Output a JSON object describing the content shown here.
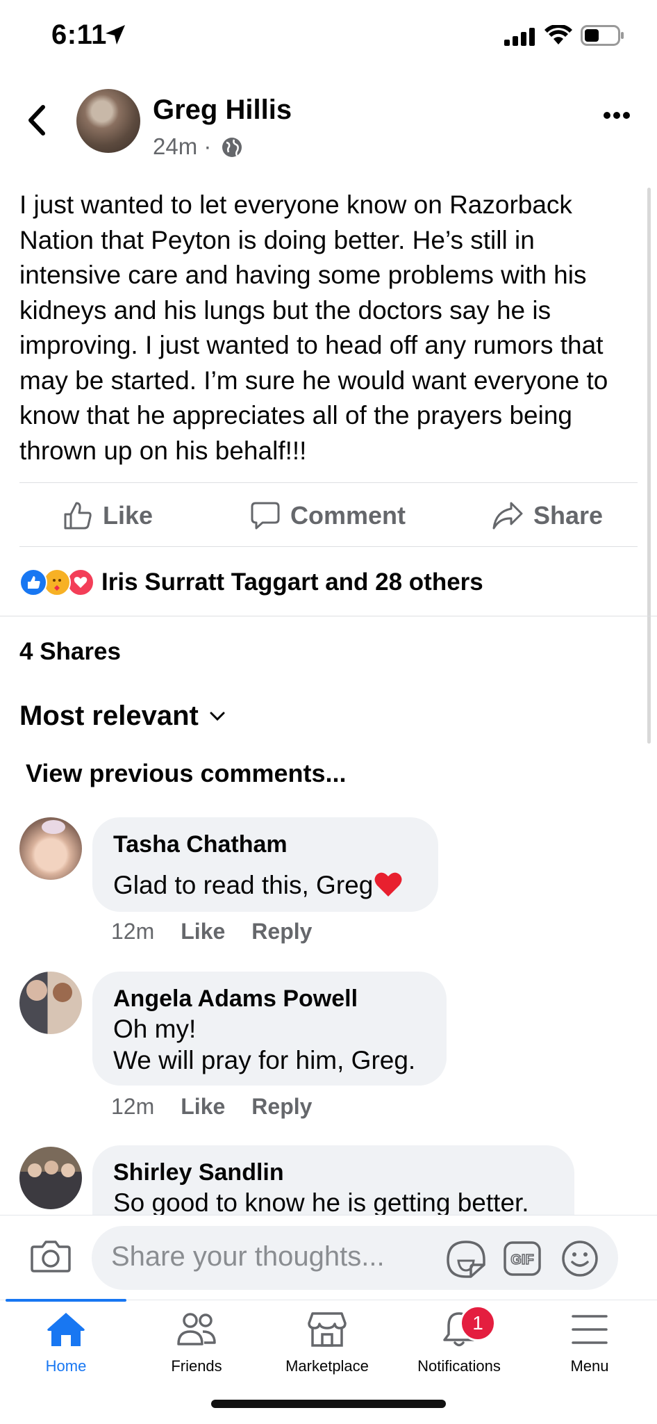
{
  "status_bar": {
    "time": "6:11"
  },
  "post": {
    "author": "Greg Hillis",
    "time": "24m ·",
    "body": "I just wanted to let everyone know on Razorback Nation that Peyton is doing better. He’s still in intensive care and having some problems with his kidneys and his lungs but the doctors say he is improving. I just wanted to head off any rumors that may be started. I’m sure he would want everyone to know that he appreciates all of the prayers being thrown up on his behalf!!!",
    "actions": {
      "like": "Like",
      "comment": "Comment",
      "share": "Share"
    },
    "reactions_text": "Iris Surratt Taggart and 28 others",
    "shares_text": "4 Shares"
  },
  "comments_section": {
    "sort_label": "Most relevant",
    "view_previous": "View previous comments...",
    "comments": [
      {
        "name": "Tasha Chatham",
        "text": "Glad to read this, Greg",
        "time": "12m",
        "like": "Like",
        "reply": "Reply"
      },
      {
        "name": "Angela Adams Powell",
        "line1": "Oh my!",
        "line2": "We will pray for him, Greg.",
        "time": "12m",
        "like": "Like",
        "reply": "Reply"
      },
      {
        "name": "Shirley Sandlin",
        "text": "So good to know he is getting better."
      }
    ]
  },
  "composer": {
    "placeholder": "Share your thoughts..."
  },
  "tabbar": {
    "home": "Home",
    "friends": "Friends",
    "marketplace": "Marketplace",
    "notifications": "Notifications",
    "notifications_badge": "1",
    "menu": "Menu"
  },
  "colors": {
    "accent": "#1877f2",
    "badge": "#e41e3f",
    "secondary_text": "#65676b",
    "bubble": "#f0f2f5"
  }
}
